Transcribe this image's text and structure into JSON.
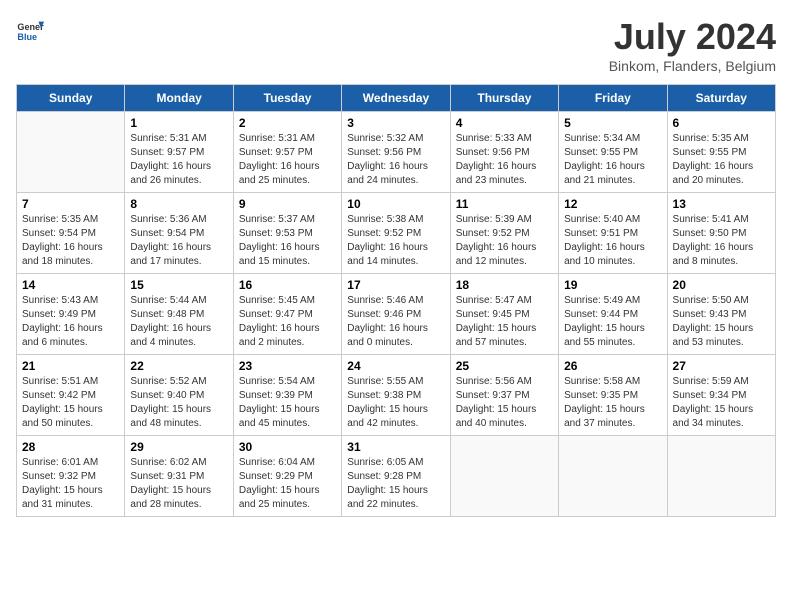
{
  "header": {
    "logo_line1": "General",
    "logo_line2": "Blue",
    "month": "July 2024",
    "location": "Binkom, Flanders, Belgium"
  },
  "weekdays": [
    "Sunday",
    "Monday",
    "Tuesday",
    "Wednesday",
    "Thursday",
    "Friday",
    "Saturday"
  ],
  "weeks": [
    [
      {
        "day": "",
        "info": ""
      },
      {
        "day": "1",
        "info": "Sunrise: 5:31 AM\nSunset: 9:57 PM\nDaylight: 16 hours\nand 26 minutes."
      },
      {
        "day": "2",
        "info": "Sunrise: 5:31 AM\nSunset: 9:57 PM\nDaylight: 16 hours\nand 25 minutes."
      },
      {
        "day": "3",
        "info": "Sunrise: 5:32 AM\nSunset: 9:56 PM\nDaylight: 16 hours\nand 24 minutes."
      },
      {
        "day": "4",
        "info": "Sunrise: 5:33 AM\nSunset: 9:56 PM\nDaylight: 16 hours\nand 23 minutes."
      },
      {
        "day": "5",
        "info": "Sunrise: 5:34 AM\nSunset: 9:55 PM\nDaylight: 16 hours\nand 21 minutes."
      },
      {
        "day": "6",
        "info": "Sunrise: 5:35 AM\nSunset: 9:55 PM\nDaylight: 16 hours\nand 20 minutes."
      }
    ],
    [
      {
        "day": "7",
        "info": "Sunrise: 5:35 AM\nSunset: 9:54 PM\nDaylight: 16 hours\nand 18 minutes."
      },
      {
        "day": "8",
        "info": "Sunrise: 5:36 AM\nSunset: 9:54 PM\nDaylight: 16 hours\nand 17 minutes."
      },
      {
        "day": "9",
        "info": "Sunrise: 5:37 AM\nSunset: 9:53 PM\nDaylight: 16 hours\nand 15 minutes."
      },
      {
        "day": "10",
        "info": "Sunrise: 5:38 AM\nSunset: 9:52 PM\nDaylight: 16 hours\nand 14 minutes."
      },
      {
        "day": "11",
        "info": "Sunrise: 5:39 AM\nSunset: 9:52 PM\nDaylight: 16 hours\nand 12 minutes."
      },
      {
        "day": "12",
        "info": "Sunrise: 5:40 AM\nSunset: 9:51 PM\nDaylight: 16 hours\nand 10 minutes."
      },
      {
        "day": "13",
        "info": "Sunrise: 5:41 AM\nSunset: 9:50 PM\nDaylight: 16 hours\nand 8 minutes."
      }
    ],
    [
      {
        "day": "14",
        "info": "Sunrise: 5:43 AM\nSunset: 9:49 PM\nDaylight: 16 hours\nand 6 minutes."
      },
      {
        "day": "15",
        "info": "Sunrise: 5:44 AM\nSunset: 9:48 PM\nDaylight: 16 hours\nand 4 minutes."
      },
      {
        "day": "16",
        "info": "Sunrise: 5:45 AM\nSunset: 9:47 PM\nDaylight: 16 hours\nand 2 minutes."
      },
      {
        "day": "17",
        "info": "Sunrise: 5:46 AM\nSunset: 9:46 PM\nDaylight: 16 hours\nand 0 minutes."
      },
      {
        "day": "18",
        "info": "Sunrise: 5:47 AM\nSunset: 9:45 PM\nDaylight: 15 hours\nand 57 minutes."
      },
      {
        "day": "19",
        "info": "Sunrise: 5:49 AM\nSunset: 9:44 PM\nDaylight: 15 hours\nand 55 minutes."
      },
      {
        "day": "20",
        "info": "Sunrise: 5:50 AM\nSunset: 9:43 PM\nDaylight: 15 hours\nand 53 minutes."
      }
    ],
    [
      {
        "day": "21",
        "info": "Sunrise: 5:51 AM\nSunset: 9:42 PM\nDaylight: 15 hours\nand 50 minutes."
      },
      {
        "day": "22",
        "info": "Sunrise: 5:52 AM\nSunset: 9:40 PM\nDaylight: 15 hours\nand 48 minutes."
      },
      {
        "day": "23",
        "info": "Sunrise: 5:54 AM\nSunset: 9:39 PM\nDaylight: 15 hours\nand 45 minutes."
      },
      {
        "day": "24",
        "info": "Sunrise: 5:55 AM\nSunset: 9:38 PM\nDaylight: 15 hours\nand 42 minutes."
      },
      {
        "day": "25",
        "info": "Sunrise: 5:56 AM\nSunset: 9:37 PM\nDaylight: 15 hours\nand 40 minutes."
      },
      {
        "day": "26",
        "info": "Sunrise: 5:58 AM\nSunset: 9:35 PM\nDaylight: 15 hours\nand 37 minutes."
      },
      {
        "day": "27",
        "info": "Sunrise: 5:59 AM\nSunset: 9:34 PM\nDaylight: 15 hours\nand 34 minutes."
      }
    ],
    [
      {
        "day": "28",
        "info": "Sunrise: 6:01 AM\nSunset: 9:32 PM\nDaylight: 15 hours\nand 31 minutes."
      },
      {
        "day": "29",
        "info": "Sunrise: 6:02 AM\nSunset: 9:31 PM\nDaylight: 15 hours\nand 28 minutes."
      },
      {
        "day": "30",
        "info": "Sunrise: 6:04 AM\nSunset: 9:29 PM\nDaylight: 15 hours\nand 25 minutes."
      },
      {
        "day": "31",
        "info": "Sunrise: 6:05 AM\nSunset: 9:28 PM\nDaylight: 15 hours\nand 22 minutes."
      },
      {
        "day": "",
        "info": ""
      },
      {
        "day": "",
        "info": ""
      },
      {
        "day": "",
        "info": ""
      }
    ]
  ]
}
